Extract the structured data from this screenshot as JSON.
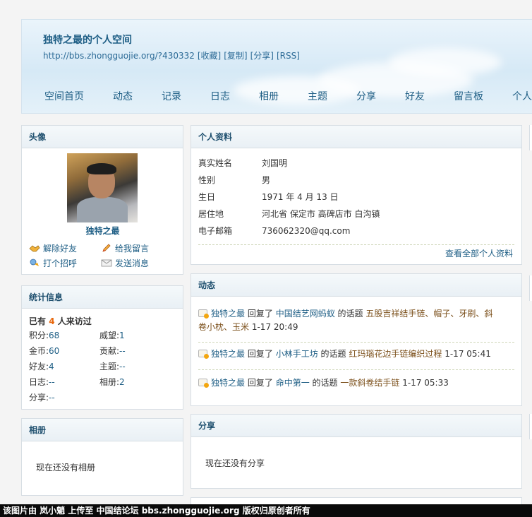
{
  "header": {
    "title": "独特之最的个人空间",
    "url": "http://bbs.zhongguojie.org/?430332",
    "url_actions": [
      "[收藏]",
      "[复制]",
      "[分享]",
      "[RSS]"
    ],
    "nav": [
      "空间首页",
      "动态",
      "记录",
      "日志",
      "相册",
      "主题",
      "分享",
      "好友",
      "留言板",
      "个人"
    ]
  },
  "avatar_panel": {
    "heading": "头像",
    "username": "独特之最",
    "actions": {
      "remove_friend": "解除好友",
      "leave_message": "给我留言",
      "greet": "打个招呼",
      "send_message": "发送消息"
    }
  },
  "stats_panel": {
    "heading": "统计信息",
    "visitors_prefix": "已有",
    "visitors_count": "4",
    "visitors_suffix": "人来访过",
    "items": [
      {
        "label": "积分:",
        "value": "68"
      },
      {
        "label": "威望:",
        "value": "1"
      },
      {
        "label": "金币:",
        "value": "60"
      },
      {
        "label": "贡献:",
        "value": "--"
      },
      {
        "label": "好友:",
        "value": "4"
      },
      {
        "label": "主题:",
        "value": "--"
      },
      {
        "label": "日志:",
        "value": "--"
      },
      {
        "label": "相册:",
        "value": "2"
      },
      {
        "label": "分享:",
        "value": "--"
      }
    ]
  },
  "album_panel": {
    "heading": "相册",
    "empty": "现在还没有相册"
  },
  "profile_panel": {
    "heading": "个人资料",
    "rows": [
      {
        "key": "真实姓名",
        "value": "刘国明"
      },
      {
        "key": "性别",
        "value": "男"
      },
      {
        "key": "生日",
        "value": "1971 年 4 月 13 日"
      },
      {
        "key": "居住地",
        "value": "河北省 保定市 高碑店市 白沟镇"
      },
      {
        "key": "电子邮箱",
        "value": "736062320@qq.com"
      }
    ],
    "more_link": "查看全部个人资料"
  },
  "feed_panel": {
    "heading": "动态",
    "items": [
      {
        "user": "独特之最",
        "verb": "回复了",
        "author": "中国结艺网蚂蚁",
        "mid": "的话题",
        "thread": "五股吉祥结手链、帽子、牙刷、斜卷小枕、玉米",
        "time": "1-17 20:49"
      },
      {
        "user": "独特之最",
        "verb": "回复了",
        "author": "小林手工坊",
        "mid": "的话题",
        "thread": "红玛瑙花边手链编织过程",
        "time": "1-17 05:41"
      },
      {
        "user": "独特之最",
        "verb": "回复了",
        "author": "命中第一",
        "mid": "的话题",
        "thread": "一款斜卷结手链",
        "time": "1-17 05:33"
      }
    ]
  },
  "share_panel": {
    "heading": "分享",
    "empty": "现在还没有分享"
  },
  "footer": {
    "text": "该图片由 岚小魈 上传至 中国结论坛 bbs.zhongguojie.org 版权归原创者所有"
  }
}
